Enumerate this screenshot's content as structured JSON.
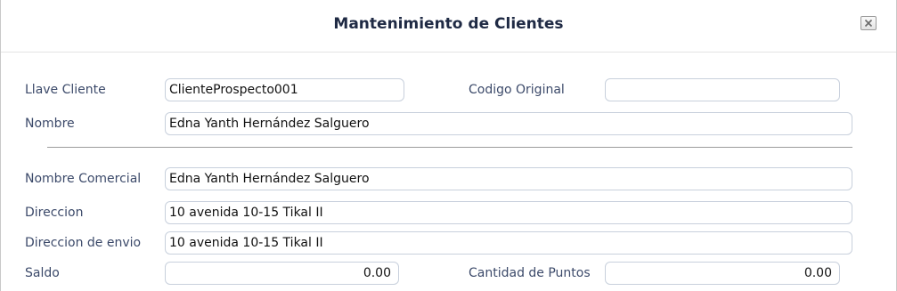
{
  "dialog": {
    "title": "Mantenimiento de Clientes",
    "close_icon": "close-icon"
  },
  "form": {
    "llave_cliente": {
      "label": "Llave Cliente",
      "value": "ClienteProspecto001"
    },
    "codigo_original": {
      "label": "Codigo Original",
      "value": ""
    },
    "nombre": {
      "label": "Nombre",
      "value": "Edna Yanth Hernández Salguero"
    },
    "nombre_comercial": {
      "label": "Nombre Comercial",
      "value": "Edna Yanth Hernández Salguero"
    },
    "direccion": {
      "label": "Direccion",
      "value": "10 avenida 10-15 Tikal II"
    },
    "direccion_envio": {
      "label": "Direccion de envio",
      "value": "10 avenida 10-15 Tikal II"
    },
    "saldo": {
      "label": "Saldo",
      "value": "0.00"
    },
    "cantidad_puntos": {
      "label": "Cantidad de Puntos",
      "value": "0.00"
    }
  },
  "colors": {
    "title": "#1f2a44",
    "label": "#3c4a6a",
    "field_border": "#c8d0dc",
    "divider": "#9c9c9c"
  }
}
